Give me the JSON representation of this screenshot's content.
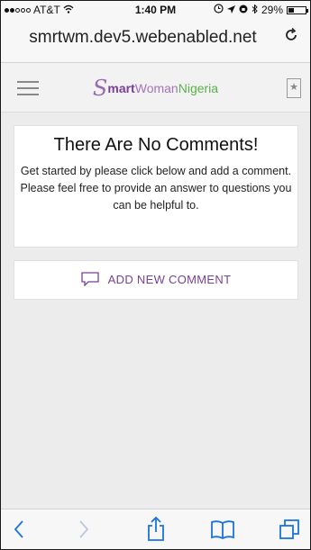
{
  "status": {
    "carrier": "AT&T",
    "time": "1:40 PM",
    "battery": "29%",
    "signal_bars": 2
  },
  "browser": {
    "url": "smrtwm.dev5.webenabled.net",
    "reload_icon": "reload-icon",
    "reload_glyph": "C"
  },
  "site": {
    "logo": {
      "s": "S",
      "smart": "mart",
      "woman": "Woman",
      "nigeria": "Nigeria"
    },
    "bookmark_glyph": "★"
  },
  "main": {
    "empty_title": "There Are No Comments!",
    "empty_lines": [
      "Get started by please click below and add a comment.",
      "Please feel free to provide an answer to questions you can be helpful to."
    ],
    "add_comment_label": "ADD NEW COMMENT"
  },
  "toolbar": {
    "icons": [
      "back-icon",
      "forward-icon",
      "share-icon",
      "bookmarks-icon",
      "tabs-icon"
    ]
  },
  "colors": {
    "accent_purple": "#7a3f96",
    "green": "#59b24a",
    "ios_blue": "#1a73d9"
  }
}
